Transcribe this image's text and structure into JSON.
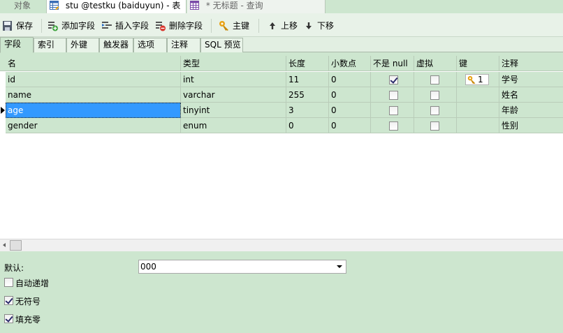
{
  "doc_tabs": {
    "objects": "对象",
    "active": "stu @testku (baiduyun) - 表",
    "query": "* 无标题 - 查询"
  },
  "toolbar": {
    "save": "保存",
    "add_field": "添加字段",
    "insert_field": "插入字段",
    "delete_field": "删除字段",
    "primary_key": "主键",
    "move_up": "上移",
    "move_down": "下移"
  },
  "sub_tabs": [
    "字段",
    "索引",
    "外键",
    "触发器",
    "选项",
    "注释",
    "SQL 预览"
  ],
  "columns": [
    "名",
    "类型",
    "长度",
    "小数点",
    "不是 null",
    "虚拟",
    "键",
    "注释"
  ],
  "rows": [
    {
      "name": "id",
      "type": "int",
      "length": "11",
      "decimals": "0",
      "not_null": true,
      "virtual": false,
      "key": "1",
      "comment": "学号"
    },
    {
      "name": "name",
      "type": "varchar",
      "length": "255",
      "decimals": "0",
      "not_null": false,
      "virtual": false,
      "key": "",
      "comment": "姓名"
    },
    {
      "name": "age",
      "type": "tinyint",
      "length": "3",
      "decimals": "0",
      "not_null": false,
      "virtual": false,
      "key": "",
      "comment": "年龄"
    },
    {
      "name": "gender",
      "type": "enum",
      "length": "0",
      "decimals": "0",
      "not_null": false,
      "virtual": false,
      "key": "",
      "comment": "性别"
    }
  ],
  "selected_row": 2,
  "props": {
    "default_label": "默认:",
    "default_value": "000",
    "auto_increment_label": "自动递增",
    "auto_increment": false,
    "unsigned_label": "无符号",
    "unsigned": true,
    "zerofill_label": "填充零",
    "zerofill": true
  },
  "colors": {
    "background": "#cde6cf",
    "selection": "#3399ff",
    "key_icon": "#e8a317"
  }
}
